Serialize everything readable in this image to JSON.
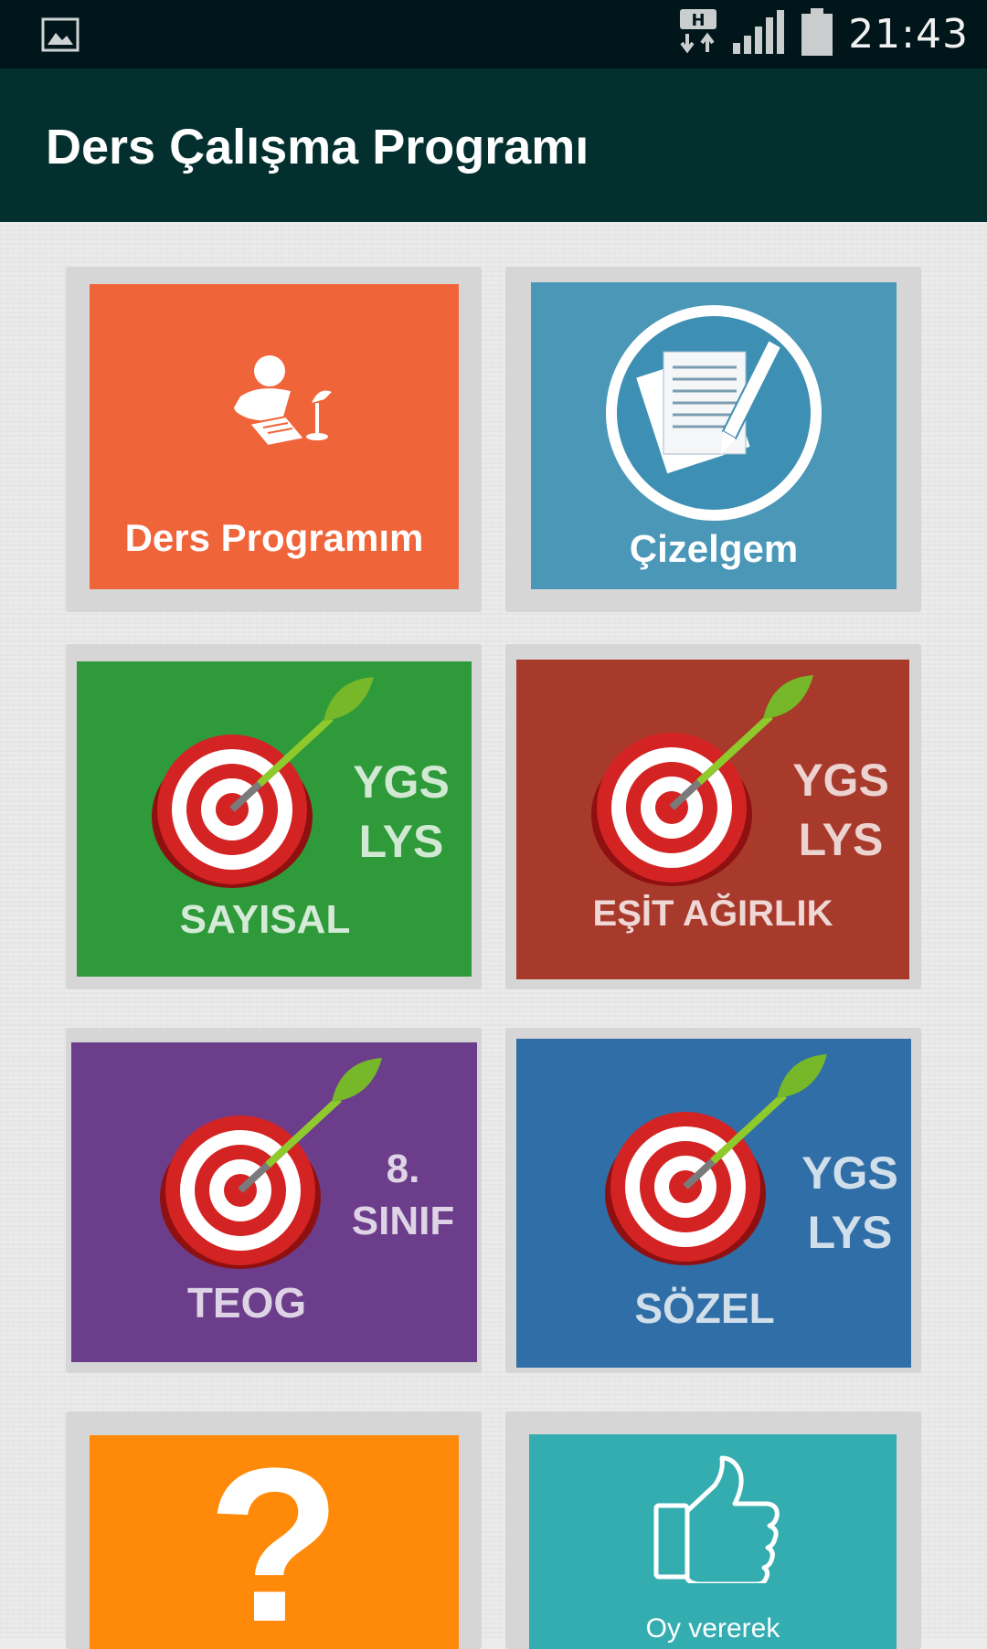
{
  "status_bar": {
    "time": "21:43",
    "icons": [
      "image-notification-icon",
      "h-data-icon",
      "signal-icon",
      "battery-icon"
    ],
    "network_badge": "H"
  },
  "app_bar": {
    "title": "Ders Çalışma Programı",
    "color": "#03302f"
  },
  "tiles": [
    {
      "label": "Ders Programım",
      "color": "#f0643a",
      "icon": "student-desk-icon"
    },
    {
      "label": "Çizelgem",
      "color": "#4a97b8",
      "icon": "document-pen-icon"
    },
    {
      "label": "SAYISAL",
      "line1": "YGS",
      "line2": "LYS",
      "color": "#2e9a3a",
      "icon": "target-dart-icon"
    },
    {
      "label": "EŞİT AĞIRLIK",
      "line1": "YGS",
      "line2": "LYS",
      "color": "#a83a2c",
      "icon": "target-dart-icon"
    },
    {
      "label": "TEOG",
      "line1": "8.",
      "line2": "SINIF",
      "color": "#6b3d8b",
      "icon": "target-dart-icon"
    },
    {
      "label": "SÖZEL",
      "line1": "YGS",
      "line2": "LYS",
      "color": "#2f6ea6",
      "icon": "target-dart-icon"
    },
    {
      "label": "?",
      "color": "#ff8a0a",
      "icon": "question-mark-icon"
    },
    {
      "label": "Oy vererek",
      "color": "#34adb1",
      "icon": "thumbs-up-icon"
    }
  ]
}
